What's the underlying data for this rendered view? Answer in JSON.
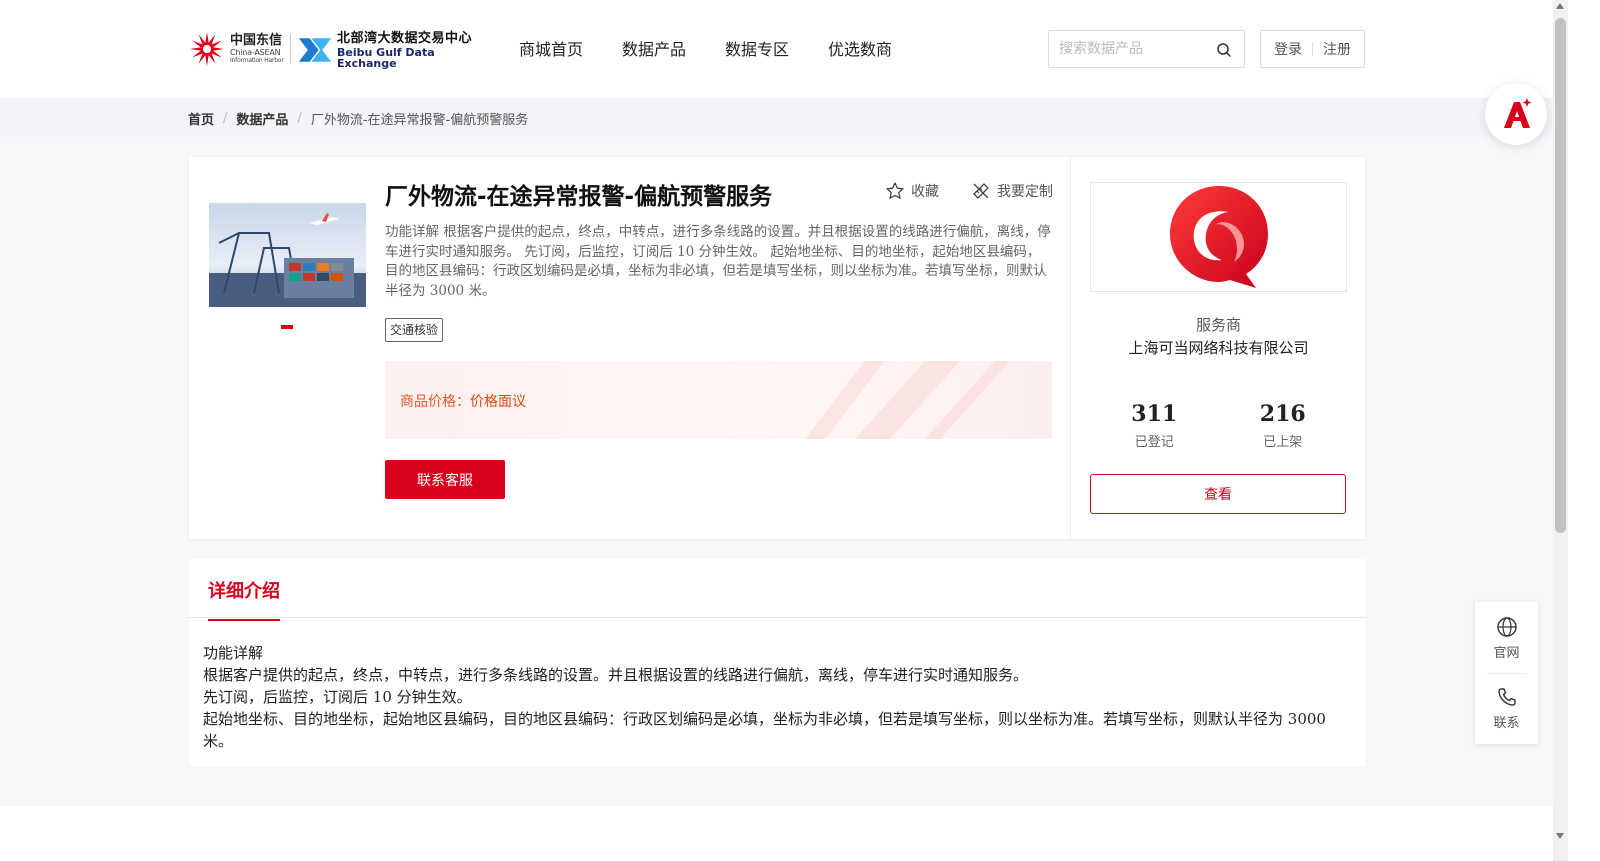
{
  "header": {
    "logo_cn": {
      "big": "中国东信",
      "small1": "China-ASEAN",
      "small2": "Information Harbor"
    },
    "logo_bg": {
      "big": "北部湾大数据交易中心",
      "small": "Beibu Gulf Data Exchange"
    },
    "nav": [
      "商城首页",
      "数据产品",
      "数据专区",
      "优选数商"
    ],
    "search_placeholder": "搜索数据产品",
    "login": "登录",
    "register": "注册"
  },
  "breadcrumb": {
    "home": "首页",
    "category": "数据产品",
    "current": "厂外物流-在途异常报警-偏航预警服务"
  },
  "product": {
    "title": "厂外物流-在途异常报警-偏航预警服务",
    "favorite": "收藏",
    "customize": "我要定制",
    "description": "功能详解 根据客户提供的起点，终点，中转点，进行多条线路的设置。并且根据设置的线路进行偏航，离线，停车进行实时通知服务。  先订阅，后监控，订阅后 10 分钟生效。  起始地坐标、目的地坐标，起始地区县编码，目的地区县编码：行政区划编码是必填，坐标为非必填，但若是填写坐标，则以坐标为准。若填写坐标，则默认半径为 3000 米。",
    "tag": "交通核验",
    "price_label": "商品价格：",
    "price_value": "价格面议",
    "contact_button": "联系客服"
  },
  "vendor": {
    "role": "服务商",
    "name": "上海可当网络科技有限公司",
    "registered_count": "311",
    "registered_label": "已登记",
    "listed_count": "216",
    "listed_label": "已上架",
    "view_button": "查看"
  },
  "detail": {
    "tab": "详细介绍",
    "lines": [
      "功能详解",
      " 根据客户提供的起点，终点，中转点，进行多条线路的设置。并且根据设置的线路进行偏航，离线，停车进行实时通知服务。",
      " 先订阅，后监控，订阅后 10 分钟生效。",
      " 起始地坐标、目的地坐标，起始地区县编码，目的地区县编码：行政区划编码是必填，坐标为非必填，但若是填写坐标，则以坐标为准。若填写坐标，则默认半径为 3000 米。"
    ]
  },
  "side": {
    "website": "官网",
    "contact": "联系"
  },
  "colors": {
    "brand_red": "#d9001b",
    "price_orange": "#e4572e",
    "crumb_bg": "#f2f4f7"
  }
}
